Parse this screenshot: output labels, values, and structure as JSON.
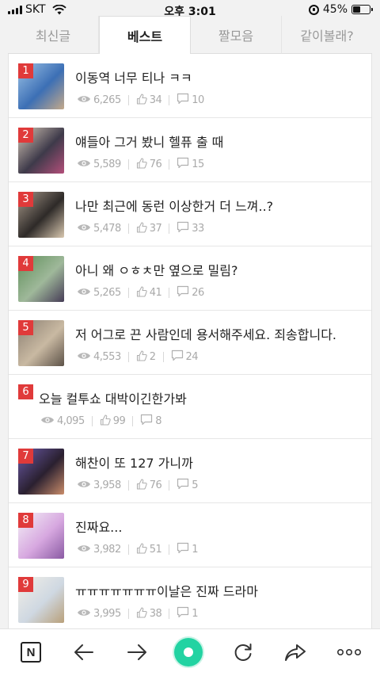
{
  "status_bar": {
    "carrier": "SKT",
    "time": "오후 3:01",
    "battery": "45%",
    "battery_level": 0.45
  },
  "tabs": [
    {
      "label": "최신글",
      "active": false
    },
    {
      "label": "베스트",
      "active": true
    },
    {
      "label": "짤모음",
      "active": false
    },
    {
      "label": "같이볼래?",
      "active": false
    }
  ],
  "posts": [
    {
      "rank": "1",
      "title": "이동역 너무 티나 ㅋㅋ",
      "views": "6,265",
      "likes": "34",
      "comments": "10",
      "has_thumb": true,
      "thumb_colors": [
        "#9dc3e6",
        "#3c6fb5",
        "#c4a98a"
      ]
    },
    {
      "rank": "2",
      "title": "얘들아 그거 봤니 헬퓨 출 때",
      "views": "5,589",
      "likes": "76",
      "comments": "15",
      "has_thumb": true,
      "thumb_colors": [
        "#d7c9b7",
        "#3e3a4a",
        "#b34f7a"
      ]
    },
    {
      "rank": "3",
      "title": "나만 최근에 동런 이상한거 더 느껴..?",
      "views": "5,478",
      "likes": "37",
      "comments": "33",
      "has_thumb": true,
      "thumb_colors": [
        "#a89a8b",
        "#2e2a28",
        "#d9c8b0"
      ]
    },
    {
      "rank": "4",
      "title": "아니 왜 ㅇㅎㅊ만 옆으로 밀림?",
      "views": "5,265",
      "likes": "41",
      "comments": "26",
      "has_thumb": true,
      "thumb_colors": [
        "#5f8f5a",
        "#9fb89a",
        "#463c56"
      ]
    },
    {
      "rank": "5",
      "title": "저 어그로 끈 사람인데 용서해주세요. 죄송합니다.",
      "views": "4,553",
      "likes": "2",
      "comments": "24",
      "has_thumb": true,
      "thumb_colors": [
        "#8a7f72",
        "#c9b9a2",
        "#5d5248"
      ]
    },
    {
      "rank": "6",
      "title": "오늘 컬투쇼 대박이긴한가봐",
      "views": "4,095",
      "likes": "99",
      "comments": "8",
      "has_thumb": false,
      "thumb_colors": []
    },
    {
      "rank": "7",
      "title": "해찬이 또 127 가니까",
      "views": "3,958",
      "likes": "76",
      "comments": "5",
      "has_thumb": true,
      "thumb_colors": [
        "#6b5aa8",
        "#2a2030",
        "#c98c6a"
      ]
    },
    {
      "rank": "8",
      "title": "진짜요...",
      "views": "3,982",
      "likes": "51",
      "comments": "1",
      "has_thumb": true,
      "thumb_colors": [
        "#f4f1f6",
        "#d7a8e0",
        "#8a5aa3"
      ]
    },
    {
      "rank": "9",
      "title": "ㅠㅠㅠㅠㅠㅠㅠ이날은 진짜 드라마",
      "views": "3,995",
      "likes": "38",
      "comments": "1",
      "has_thumb": true,
      "thumb_colors": [
        "#f2efe6",
        "#cfd8e2",
        "#b9a07a"
      ]
    }
  ],
  "bottom_bar": {
    "naver_label": "N",
    "icons": [
      "naver-home-icon",
      "back-arrow-icon",
      "forward-arrow-icon",
      "green-dot-icon",
      "refresh-icon",
      "share-icon",
      "more-icon"
    ]
  },
  "colors": {
    "rank_badge": "#e03a3a",
    "green_button": "#22d3a2",
    "meta_text": "#a9a9a9"
  }
}
